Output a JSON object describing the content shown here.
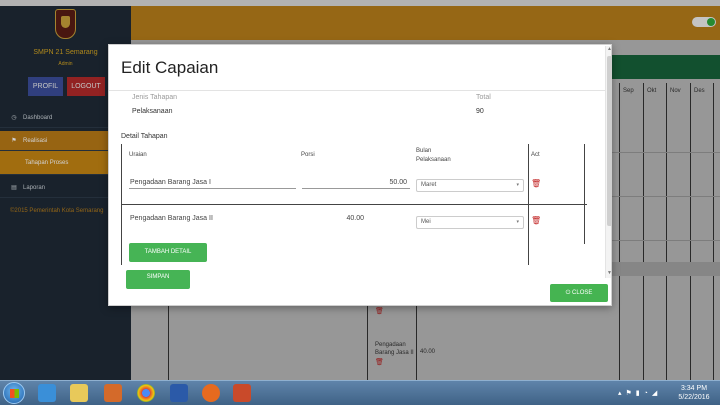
{
  "app": {
    "school_name": "SMPN 21 Semarang",
    "school_sub": "Admin",
    "buttons": {
      "profil": "PROFIL",
      "logout": "LOGOUT"
    },
    "nav": {
      "dashboard": "Dashboard",
      "realisasi": "Realisasi",
      "tahapan_proses": "Tahapan Proses",
      "laporan": "Laporan"
    },
    "copyright": "©2015 Pemerintah Kota Semarang",
    "months": [
      "Sep",
      "Okt",
      "Nov",
      "Des"
    ],
    "bg_rows": [
      {
        "label": "Pengadaan Barang Jasa II",
        "value": "40.00"
      }
    ]
  },
  "modal": {
    "title": "Edit Capaian",
    "jenis_tahapan_label": "Jenis Tahapan",
    "jenis_tahapan_value": "Pelaksanaan",
    "total_label": "Total",
    "total_value": "90",
    "detail_label": "Detail Tahapan",
    "table": {
      "headers": {
        "uraian": "Uraian",
        "porsi": "Porsi",
        "bulan": "Bulan Pelaksanaan",
        "act": "Act"
      },
      "rows": [
        {
          "uraian": "Pengadaan Barang Jasa I",
          "porsi": "50.00",
          "bulan": "Maret"
        },
        {
          "uraian": "Pengadaan Barang Jasa II",
          "porsi": "40.00",
          "bulan": "Mei"
        }
      ]
    },
    "tambah_detail": "TAMBAH DETAIL",
    "simpan": "SIMPAN",
    "close": "CLOSE"
  },
  "taskbar": {
    "time": "3:34 PM",
    "date": "5/22/2016"
  },
  "colors": {
    "accent_orange": "#b77e1a",
    "sidebar": "#1f2a36",
    "button_green": "#46b455",
    "trash_red": "#c22424"
  },
  "icons": {
    "dashboard": "clock-icon",
    "realisasi": "flag-icon",
    "laporan": "book-icon",
    "trash": "trash-icon",
    "close": "power-icon"
  }
}
